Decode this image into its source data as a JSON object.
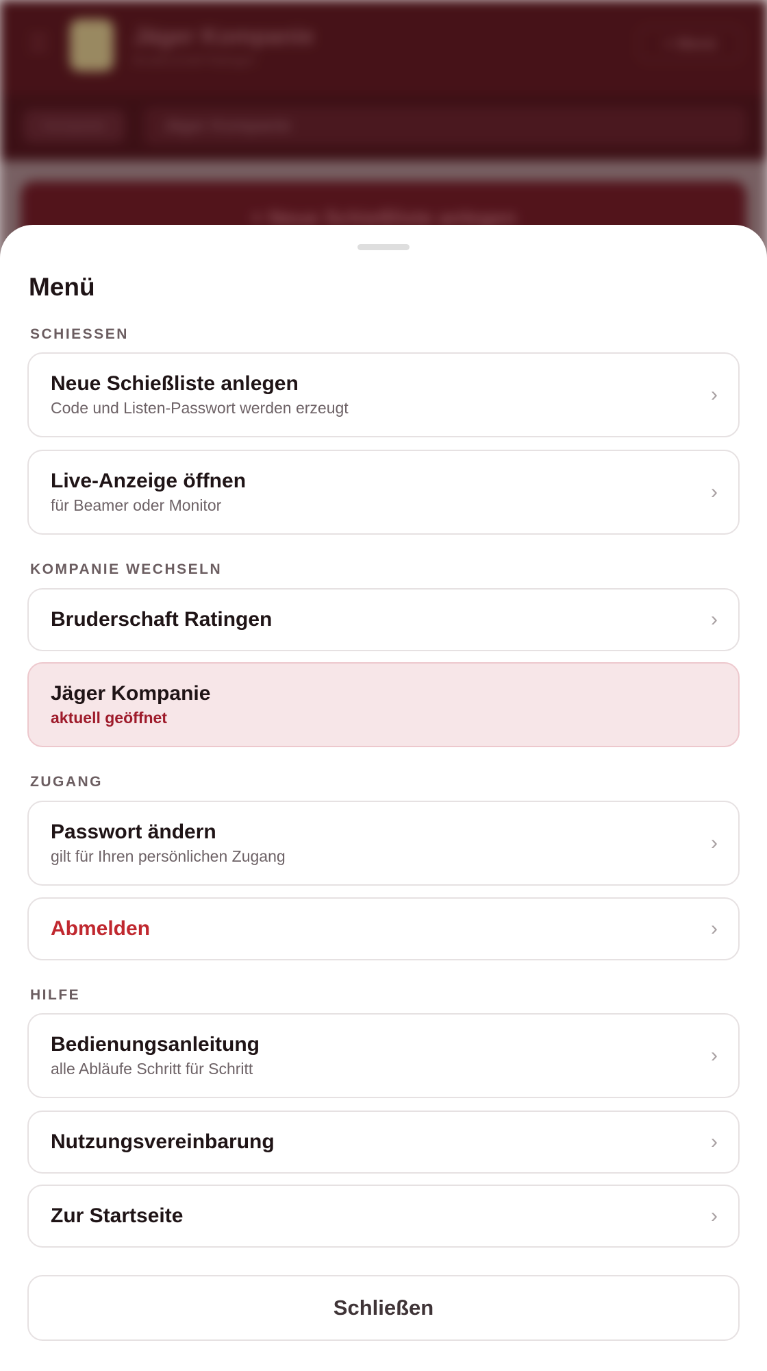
{
  "background": {
    "app_title": "Jäger Kompanie",
    "app_subtitle": "Bruderschaft Ratingen",
    "menu_button_label": "≡ Menü",
    "tab_chip_label": "Kompanie",
    "company_select_value": "Jäger Kompanie",
    "cta_label": "+ Neue Schießliste anlegen"
  },
  "sheet": {
    "title": "Menü",
    "close_label": "Schließen",
    "chevron": "›",
    "sections": {
      "schiessen": {
        "label": "SCHIESSEN",
        "items": [
          {
            "title": "Neue Schießliste anlegen",
            "subtitle": "Code und Listen-Passwort werden erzeugt"
          },
          {
            "title": "Live-Anzeige öffnen",
            "subtitle": "für Beamer oder Monitor"
          }
        ]
      },
      "kompanie": {
        "label": "KOMPANIE WECHSELN",
        "items": [
          {
            "title": "Bruderschaft Ratingen"
          },
          {
            "title": "Jäger Kompanie",
            "subtitle": "aktuell geöffnet"
          }
        ]
      },
      "zugang": {
        "label": "ZUGANG",
        "items": [
          {
            "title": "Passwort ändern",
            "subtitle": "gilt für Ihren persönlichen Zugang"
          },
          {
            "title": "Abmelden"
          }
        ]
      },
      "hilfe": {
        "label": "HILFE",
        "items": [
          {
            "title": "Bedienungsanleitung",
            "subtitle": "alle Abläufe Schritt für Schritt"
          },
          {
            "title": "Nutzungsvereinbarung"
          },
          {
            "title": "Zur Startseite"
          }
        ]
      }
    }
  },
  "colors": {
    "brand_dark": "#4a1218",
    "active_bg": "#f7e6e8",
    "active_text": "#9e1b2b",
    "danger_text": "#c0282f"
  }
}
